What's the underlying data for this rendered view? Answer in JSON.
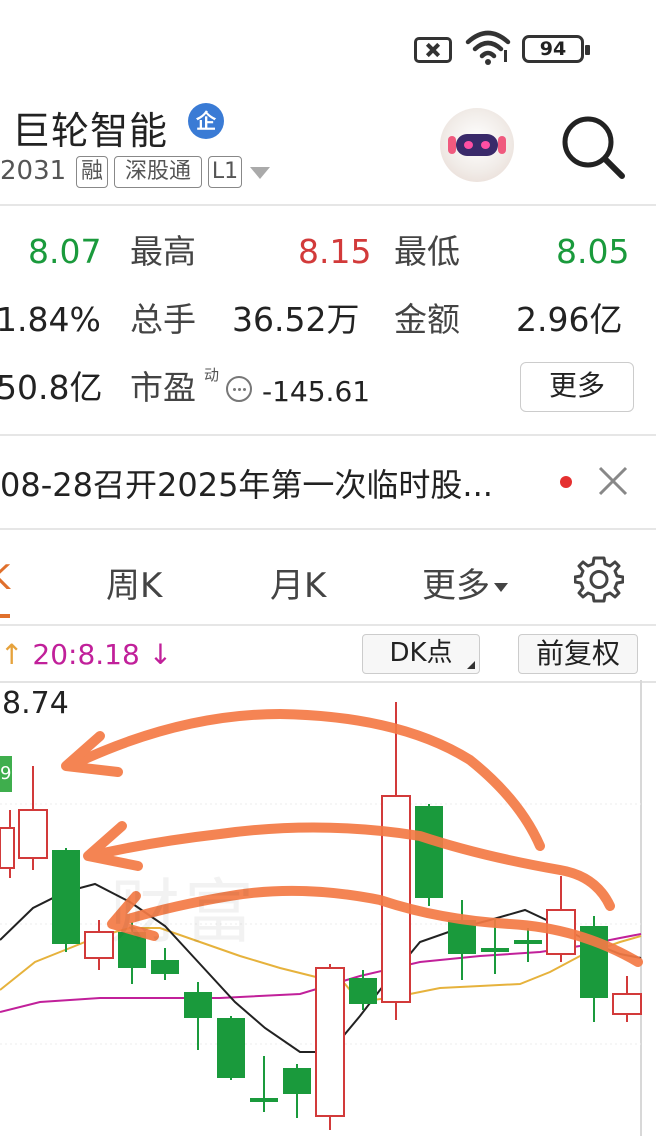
{
  "status_bar": {
    "battery_level": "94",
    "icons": [
      "sim-off-icon",
      "wifi-icon",
      "battery-icon"
    ]
  },
  "header": {
    "stock_name": "巨轮智能",
    "badge_label": "企",
    "code": "2031",
    "tags": [
      "融",
      "深股通",
      "L1"
    ],
    "icons": [
      "robot-avatar",
      "search-icon"
    ]
  },
  "quote": {
    "open_value": "8.07",
    "high_label": "最高",
    "high_value": "8.15",
    "low_label": "最低",
    "low_value": "8.05",
    "turnover_rate": "1.84%",
    "volume_label": "总手",
    "volume_value": "36.52万",
    "amount_label": "金额",
    "amount_value": "2.96亿",
    "market_cap": "50.8亿",
    "pe_label": "市盈",
    "pe_sup": "动",
    "pe_value": "-145.61",
    "more_label": "更多"
  },
  "notice": {
    "text": "08-28召开2025年第一次临时股..."
  },
  "tabs": {
    "active": "K",
    "week": "周K",
    "month": "月K",
    "more": "更多"
  },
  "chart_header": {
    "ma_prefix": "↑",
    "ma_text": "20:8.18",
    "ma_suffix": "↓",
    "dk_label": "DK点",
    "adjust_label": "前复权"
  },
  "chart": {
    "max_label": "8.74",
    "badge_text": "9",
    "watermark": "财富"
  },
  "colors": {
    "up": "#d23a3a",
    "down": "#1a9a3c",
    "accent": "#e0702c",
    "ma_yellow": "#e6a23c",
    "ma_purple": "#c1209a",
    "annotation": "#f47a45"
  }
}
